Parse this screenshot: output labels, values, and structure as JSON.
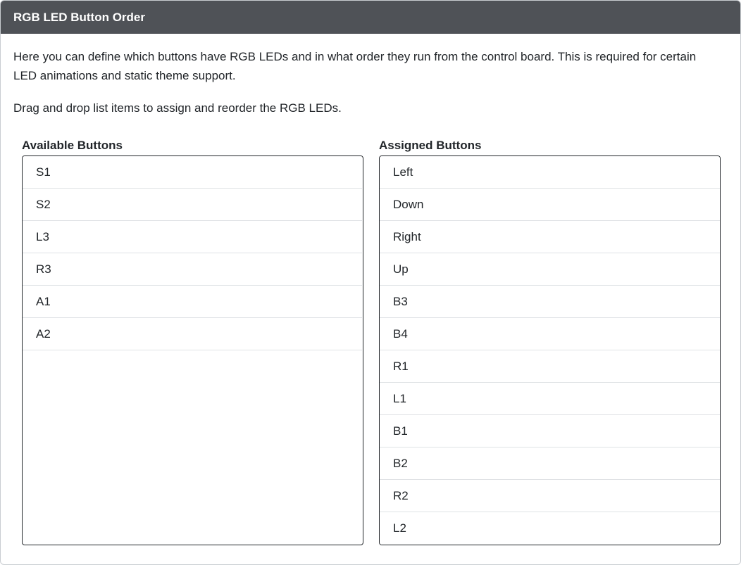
{
  "header": {
    "title": "RGB LED Button Order"
  },
  "body": {
    "description": "Here you can define which buttons have RGB LEDs and in what order they run from the control board. This is required for certain LED animations and static theme support.",
    "hint": "Drag and drop list items to assign and reorder the RGB LEDs."
  },
  "available": {
    "label": "Available Buttons",
    "items": [
      "S1",
      "S2",
      "L3",
      "R3",
      "A1",
      "A2"
    ]
  },
  "assigned": {
    "label": "Assigned Buttons",
    "items": [
      "Left",
      "Down",
      "Right",
      "Up",
      "B3",
      "B4",
      "R1",
      "L1",
      "B1",
      "B2",
      "R2",
      "L2"
    ]
  },
  "colors": {
    "header_bg": "#4f5257",
    "header_text": "#ffffff",
    "list_border": "#212529",
    "item_divider": "#dfe2e5"
  }
}
